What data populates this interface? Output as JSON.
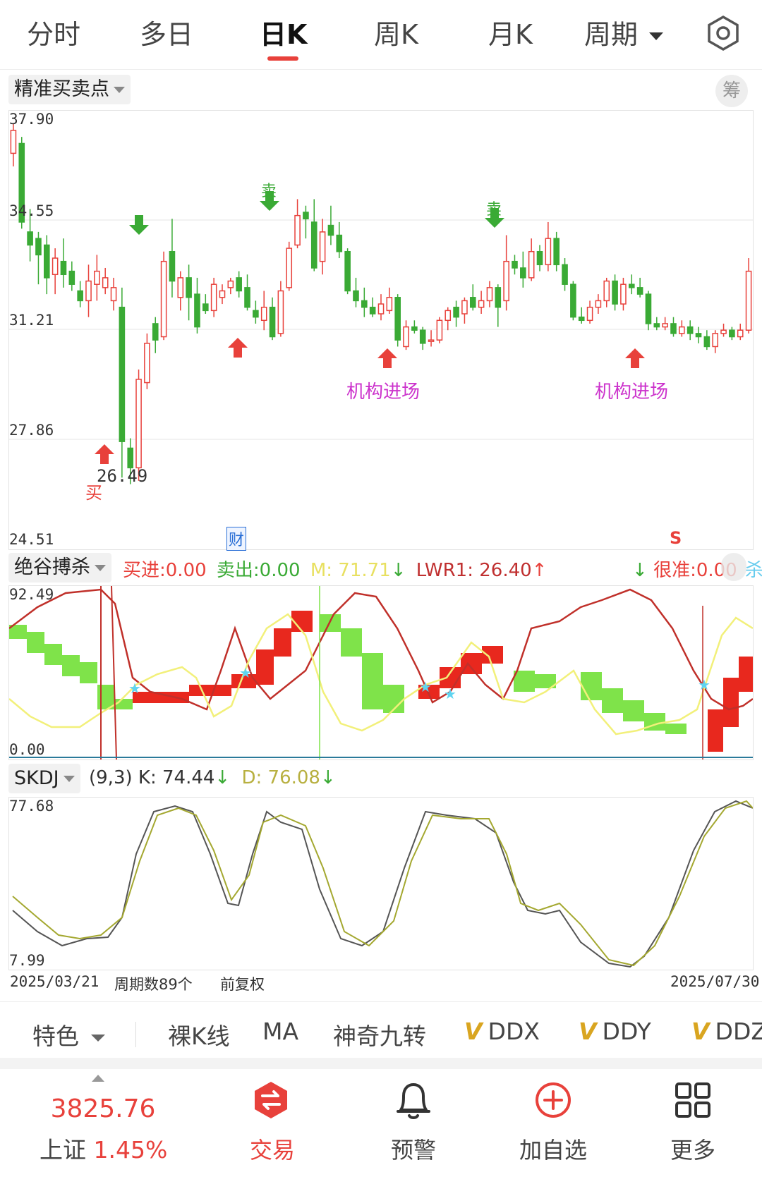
{
  "tabs": [
    {
      "label": "分时"
    },
    {
      "label": "多日"
    },
    {
      "label": "日K"
    },
    {
      "label": "周K"
    },
    {
      "label": "月K"
    },
    {
      "label": "周期"
    }
  ],
  "main_panel": {
    "indicator": "精准买卖点",
    "chip_btn": "筹",
    "y_ticks": [
      "37.90",
      "34.55",
      "31.21",
      "27.86",
      "24.51"
    ],
    "low_label": "26.49",
    "buy_label": "买",
    "sell_label": "卖",
    "inst_label": "机构进场",
    "fin_badge": "财",
    "s_marker": "S"
  },
  "mid_panel": {
    "indicator": "绝谷搏杀",
    "buy_in": "买进:0.00",
    "sell_out": "卖出:0.00",
    "m_value": "M: 71.71",
    "m_arrow": "↓",
    "lwr_value": "LWR1: 26.40",
    "lwr_arrow": "↑",
    "accurate_arrow": "↓",
    "accurate": "很准:0.00",
    "kill": "杀",
    "y_top": "92.49",
    "y_bottom": "0.00"
  },
  "skdj_panel": {
    "indicator": "SKDJ",
    "params": "(9,3)",
    "k_value": "K: 74.44",
    "k_arrow": "↓",
    "d_value": "D: 76.08",
    "d_arrow": "↓",
    "y_top": "77.68",
    "y_bottom": "7.99"
  },
  "footer_axis": {
    "start_date": "2025/03/21",
    "period_count": "周期数89个",
    "adjust": "前复权",
    "end_date": "2025/07/30"
  },
  "feature_bar": {
    "items": [
      "特色",
      "裸K线",
      "MA",
      "神奇九转",
      "DDX",
      "DDY",
      "DDZ"
    ]
  },
  "bottom_nav": {
    "index_value": "3825.76",
    "index_name": "上证",
    "index_change": "1.45%",
    "trade": "交易",
    "alert": "预警",
    "add_watch": "加自选",
    "more": "更多"
  },
  "colors": {
    "up": "#e8413b",
    "down": "#3aaa35",
    "accent": "#e8413b",
    "magenta": "#cc33cc"
  },
  "chart_data": {
    "type": "candlestick",
    "count": 89,
    "candles": [
      [
        36.6,
        37.3,
        36.2,
        37.5
      ],
      [
        36.9,
        34.5,
        34.3,
        37.1
      ],
      [
        34.2,
        33.8,
        33.3,
        34.9
      ],
      [
        34.0,
        33.5,
        32.6,
        34.2
      ],
      [
        33.8,
        32.8,
        32.3,
        34.1
      ],
      [
        32.9,
        33.4,
        32.3,
        33.7
      ],
      [
        33.3,
        32.9,
        32.5,
        34.0
      ],
      [
        33.0,
        32.6,
        32.4,
        33.3
      ],
      [
        32.4,
        32.1,
        31.9,
        32.7
      ],
      [
        32.1,
        32.7,
        31.6,
        33.2
      ],
      [
        32.6,
        33.0,
        32.1,
        33.5
      ],
      [
        32.5,
        32.8,
        32.3,
        33.1
      ],
      [
        32.1,
        32.5,
        31.8,
        32.8
      ],
      [
        31.9,
        27.8,
        26.7,
        32.5
      ],
      [
        27.6,
        27.0,
        26.5,
        27.9
      ],
      [
        27.0,
        29.7,
        26.6,
        30.0
      ],
      [
        29.6,
        30.8,
        29.4,
        31.1
      ],
      [
        31.4,
        30.9,
        30.5,
        31.6
      ],
      [
        31.0,
        33.3,
        30.9,
        33.6
      ],
      [
        33.6,
        32.7,
        32.2,
        34.6
      ],
      [
        32.2,
        32.8,
        31.8,
        33.0
      ],
      [
        32.8,
        32.2,
        31.5,
        33.2
      ],
      [
        32.3,
        31.3,
        31.1,
        32.8
      ],
      [
        32.0,
        31.8,
        31.7,
        32.3
      ],
      [
        31.8,
        32.6,
        31.6,
        32.8
      ],
      [
        32.2,
        32.4,
        32.0,
        32.6
      ],
      [
        32.5,
        32.7,
        32.3,
        32.8
      ],
      [
        32.8,
        32.4,
        32.2,
        33.0
      ],
      [
        32.5,
        31.9,
        31.8,
        32.9
      ],
      [
        31.8,
        31.6,
        31.4,
        32.1
      ],
      [
        31.5,
        31.9,
        31.2,
        32.4
      ],
      [
        31.9,
        31.0,
        30.9,
        32.2
      ],
      [
        31.1,
        32.4,
        31.0,
        32.7
      ],
      [
        32.5,
        33.7,
        32.4,
        33.9
      ],
      [
        33.8,
        34.7,
        33.7,
        35.2
      ],
      [
        34.8,
        34.6,
        34.0,
        35.0
      ],
      [
        34.5,
        33.1,
        33.0,
        35.2
      ],
      [
        33.3,
        34.2,
        32.9,
        34.6
      ],
      [
        34.4,
        34.1,
        33.8,
        35.0
      ],
      [
        34.1,
        33.6,
        33.4,
        34.5
      ],
      [
        33.6,
        32.4,
        32.3,
        33.7
      ],
      [
        32.4,
        32.1,
        31.9,
        32.8
      ],
      [
        32.1,
        31.9,
        31.6,
        32.5
      ],
      [
        31.9,
        31.7,
        31.6,
        32.2
      ],
      [
        31.7,
        32.0,
        31.5,
        32.3
      ],
      [
        31.8,
        32.2,
        31.7,
        32.5
      ],
      [
        32.2,
        30.9,
        30.7,
        32.3
      ],
      [
        30.7,
        31.3,
        30.6,
        31.5
      ],
      [
        31.3,
        31.2,
        31.1,
        31.5
      ],
      [
        31.2,
        30.8,
        30.6,
        31.3
      ],
      [
        30.9,
        30.9,
        30.7,
        31.2
      ],
      [
        30.9,
        31.5,
        30.8,
        31.6
      ],
      [
        31.5,
        31.8,
        31.2,
        31.9
      ],
      [
        31.9,
        31.6,
        31.3,
        32.1
      ],
      [
        31.7,
        32.1,
        31.4,
        32.2
      ],
      [
        32.2,
        31.9,
        31.8,
        32.6
      ],
      [
        31.9,
        32.1,
        31.7,
        32.4
      ],
      [
        32.1,
        32.5,
        31.9,
        32.7
      ],
      [
        32.5,
        31.9,
        31.3,
        32.6
      ],
      [
        32.1,
        33.3,
        31.8,
        34.1
      ],
      [
        33.3,
        33.1,
        32.9,
        33.5
      ],
      [
        33.1,
        32.8,
        32.5,
        33.6
      ],
      [
        32.8,
        33.6,
        32.7,
        34.0
      ],
      [
        33.6,
        33.2,
        33.0,
        33.8
      ],
      [
        33.2,
        34.0,
        33.0,
        34.5
      ],
      [
        34.0,
        33.2,
        33.0,
        34.2
      ],
      [
        33.2,
        32.6,
        32.4,
        33.4
      ],
      [
        32.6,
        31.6,
        31.5,
        32.7
      ],
      [
        31.6,
        31.5,
        31.4,
        31.9
      ],
      [
        31.5,
        31.9,
        31.4,
        32.1
      ],
      [
        31.9,
        32.1,
        31.7,
        32.3
      ],
      [
        32.1,
        32.7,
        31.9,
        32.8
      ],
      [
        32.7,
        32.0,
        31.8,
        32.9
      ],
      [
        32.0,
        32.6,
        31.8,
        32.8
      ],
      [
        32.6,
        32.5,
        32.3,
        32.9
      ],
      [
        32.5,
        32.3,
        32.2,
        32.8
      ],
      [
        32.3,
        31.4,
        31.2,
        32.4
      ],
      [
        31.4,
        31.3,
        31.2,
        31.6
      ],
      [
        31.3,
        31.4,
        31.2,
        31.6
      ],
      [
        31.4,
        31.1,
        31.0,
        31.6
      ],
      [
        31.1,
        31.3,
        31.0,
        31.5
      ],
      [
        31.3,
        31.1,
        30.9,
        31.5
      ],
      [
        31.1,
        31.0,
        30.8,
        31.3
      ],
      [
        31.0,
        30.7,
        30.6,
        31.2
      ],
      [
        30.7,
        31.1,
        30.5,
        31.2
      ],
      [
        31.1,
        31.2,
        31.0,
        31.4
      ],
      [
        31.2,
        31.0,
        30.9,
        31.3
      ],
      [
        31.0,
        31.2,
        30.9,
        31.4
      ],
      [
        31.2,
        33.0,
        31.1,
        33.4
      ]
    ],
    "y_range": [
      24.51,
      37.9
    ]
  }
}
